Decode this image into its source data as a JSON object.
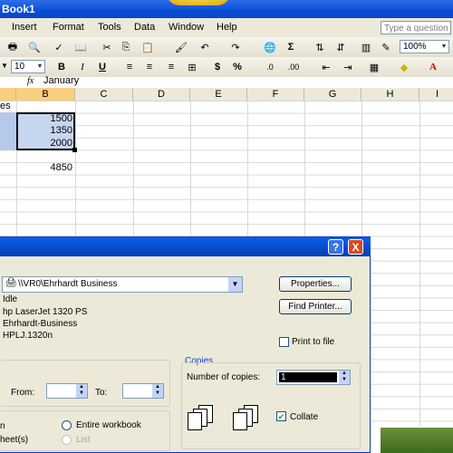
{
  "window": {
    "title": "Book1"
  },
  "menu": [
    "Insert",
    "Format",
    "Tools",
    "Data",
    "Window",
    "Help"
  ],
  "help_placeholder": "Type a question",
  "toolbar": {
    "zoom": "100%",
    "font_size": "10",
    "bold": "B",
    "italic": "I",
    "underline": "U",
    "currency": "$",
    "percent": "%",
    "sigma": "Σ"
  },
  "formula": {
    "fx": "fx",
    "value": "January"
  },
  "columns": [
    "B",
    "C",
    "D",
    "E",
    "F",
    "G",
    "H",
    "I"
  ],
  "cells": {
    "a1_fragment": "es",
    "b_values": [
      "1500",
      "1350",
      "2000"
    ],
    "b_total": "4850"
  },
  "dialog": {
    "help_btn": "?",
    "close_btn": "X",
    "printer_name": "\\\\VR0\\Ehrhardt Business",
    "status": "Idle",
    "type": "hp LaserJet 1320 PS",
    "where": "Ehrhardt-Business",
    "comment": "HPLJ.1320n",
    "properties_btn": "Properties...",
    "find_printer_btn": "Find Printer...",
    "print_to_file": "Print to file",
    "from_label": "From:",
    "to_label": "To:",
    "copies_legend": "Copies",
    "num_copies_label": "Number of copies:",
    "num_copies_value": "1",
    "collate": "Collate",
    "entire_workbook": "Entire workbook",
    "selection_fragment": "n",
    "sheets_fragment": "heet(s)",
    "list": "List"
  }
}
